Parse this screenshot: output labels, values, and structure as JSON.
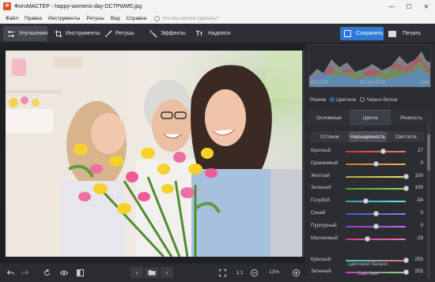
{
  "window": {
    "app_initial": "Ф",
    "title": "ФотоМАСТЕР - happy-womens-day-DCTPWM5.jpg",
    "minimize": "—",
    "maximize": "☐",
    "close": "✕"
  },
  "menu": {
    "items": [
      "Файл",
      "Правка",
      "Инструменты",
      "Ретушь",
      "Вид",
      "Справка"
    ],
    "search_placeholder": "Что вы хотите сделать?"
  },
  "toolbar": {
    "tabs": [
      {
        "label": "Улучшения",
        "icon": "sliders-icon",
        "active": true
      },
      {
        "label": "Инструменты",
        "icon": "crop-icon",
        "active": false
      },
      {
        "label": "Ретушь",
        "icon": "brush-icon",
        "active": false
      },
      {
        "label": "Эффекты",
        "icon": "magic-wand-icon",
        "active": false
      },
      {
        "label": "Надписи",
        "icon": "text-icon",
        "active": false
      }
    ],
    "text_icon_glyph": "Tт",
    "save_label": "Сохранить",
    "print_label": "Печать"
  },
  "histogram": {
    "iso": "ISO 400",
    "lens": "97 mm f/2.8",
    "shutter": "1/60"
  },
  "mode": {
    "label": "Режим",
    "options": [
      "Цветное",
      "Черно-белое"
    ],
    "selected": "Цветное"
  },
  "panel_tabs": [
    "Основные",
    "Цвета",
    "Резкость"
  ],
  "panel_tab_active": "Цвета",
  "color_modes": [
    "Оттенок",
    "Насыщенность",
    "Светлота"
  ],
  "color_mode_active": "Насыщенность",
  "sliders": [
    {
      "label": "Красный",
      "value": "27",
      "level": 0.63,
      "color_start": "#c9383a",
      "color_end": "#f07a6d"
    },
    {
      "label": "Оранжевый",
      "value": "0",
      "level": 0.5,
      "color_start": "#c9783a",
      "color_end": "#f0b06d"
    },
    {
      "label": "Желтый",
      "value": "100",
      "level": 1.0,
      "color_start": "#b7a63a",
      "color_end": "#e8e06d"
    },
    {
      "label": "Зеленый",
      "value": "100",
      "level": 1.0,
      "color_start": "#4f9a3a",
      "color_end": "#8fe06d"
    },
    {
      "label": "Голубой",
      "value": "-34",
      "level": 0.33,
      "color_start": "#3a9aa8",
      "color_end": "#6de0e8"
    },
    {
      "label": "Синий",
      "value": "0",
      "level": 0.5,
      "color_start": "#3a5ac9",
      "color_end": "#6d8df0"
    },
    {
      "label": "Пурпурный",
      "value": "0",
      "level": 0.5,
      "color_start": "#8a3ac9",
      "color_end": "#c06df0"
    },
    {
      "label": "Малиновый",
      "value": "-29",
      "level": 0.36,
      "color_start": "#c93a8a",
      "color_end": "#f06dc0"
    }
  ],
  "balance": {
    "title": "Цветовой баланс",
    "sub": "Светлые",
    "sliders": [
      {
        "label": "Красный",
        "value": "255",
        "level": 1.0,
        "color_start": "#3ac9c9",
        "color_end": "#f06d6d"
      },
      {
        "label": "Зеленый",
        "value": "255",
        "level": 1.0,
        "color_start": "#c93ac9",
        "color_end": "#6df06d"
      }
    ]
  },
  "bottom": {
    "fit_label": "1:1",
    "zoom": "13%"
  },
  "colors": {
    "accent": "#2d7ad6",
    "panel": "#2b2d31",
    "toolbar": "#2e3035"
  }
}
